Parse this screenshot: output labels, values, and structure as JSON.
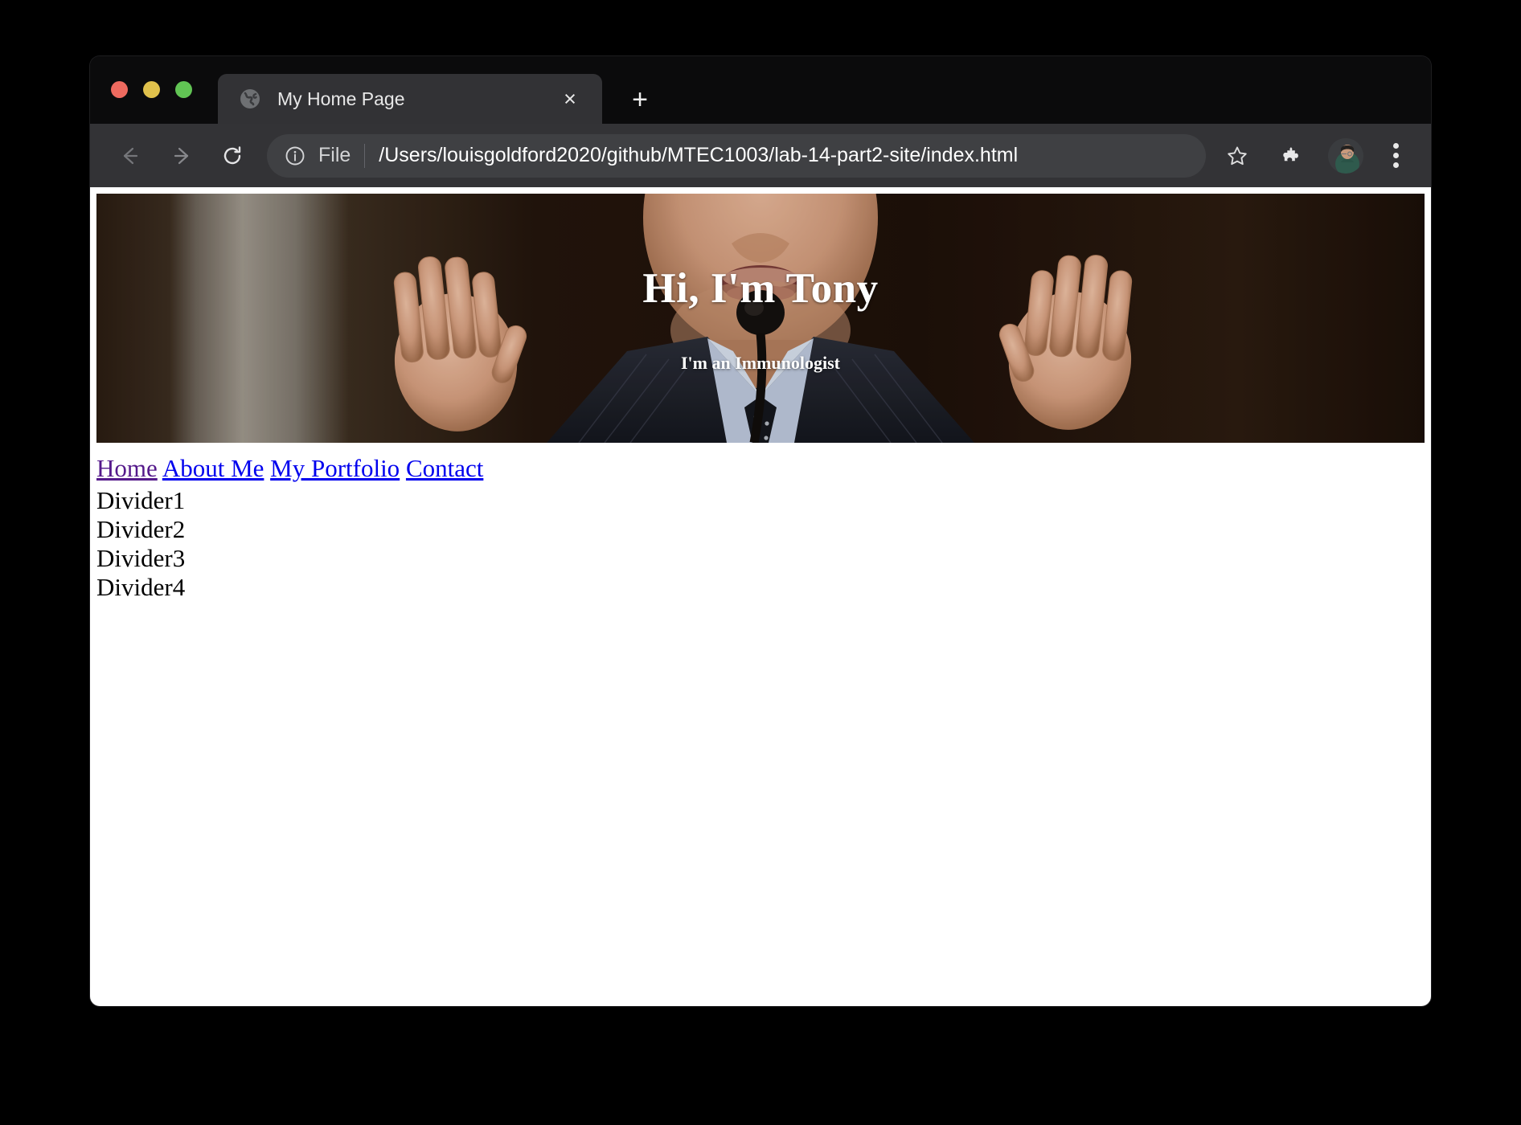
{
  "window": {
    "traffic_lights": [
      {
        "name": "close",
        "color": "#ee6a5f"
      },
      {
        "name": "minimize",
        "color": "#e0c14c"
      },
      {
        "name": "zoom",
        "color": "#61c454"
      }
    ]
  },
  "tab_strip": {
    "tab": {
      "title": "My Home Page",
      "favicon": "globe-icon",
      "close_label": "×"
    },
    "new_tab_label": "+"
  },
  "toolbar": {
    "back_icon": "back-arrow-icon",
    "forward_icon": "forward-arrow-icon",
    "reload_icon": "reload-icon",
    "omnibox": {
      "security_icon": "info-circle-icon",
      "scheme_label": "File",
      "url": "/Users/louisgoldford2020/github/MTEC1003/lab-14-part2-site/index.html"
    },
    "bookmark_icon": "star-icon",
    "extensions_icon": "puzzle-piece-icon",
    "avatar_name": "profile-avatar",
    "menu_icon": "three-dot-menu-icon"
  },
  "page": {
    "hero": {
      "title": "Hi, I'm Tony",
      "subtitle": "I'm an Immunologist",
      "image_alt": "man-gesturing-at-microphone"
    },
    "nav": [
      {
        "label": "Home",
        "visited": true
      },
      {
        "label": "About Me",
        "visited": false
      },
      {
        "label": "My Portfolio",
        "visited": false
      },
      {
        "label": "Contact",
        "visited": false
      }
    ],
    "dividers": [
      "Divider1",
      "Divider2",
      "Divider3",
      "Divider4"
    ]
  },
  "colors": {
    "link": "#0000ee",
    "link_visited": "#551a8b",
    "tab_bar": "#0b0b0c",
    "toolbar": "#333336",
    "omnibox": "#3f4043"
  }
}
